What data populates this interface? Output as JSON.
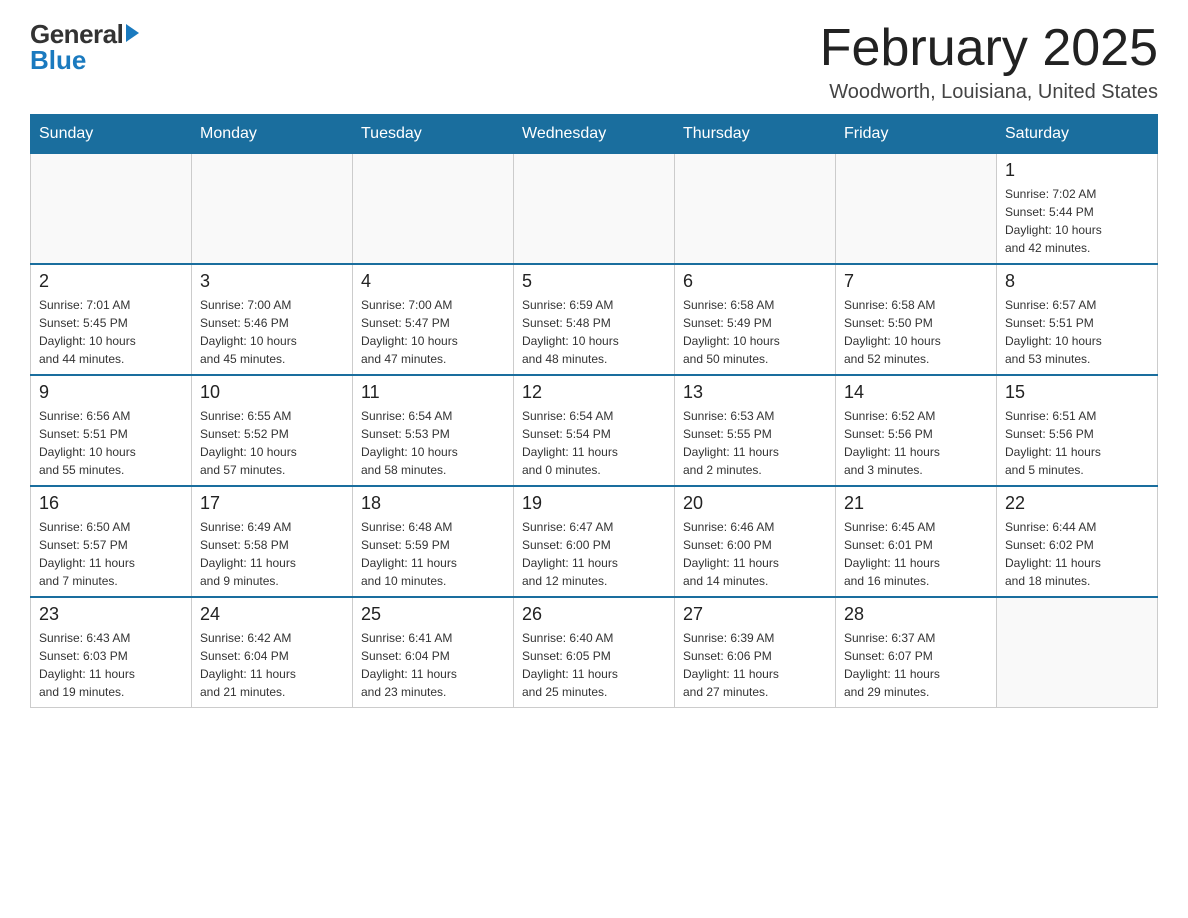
{
  "logo": {
    "general": "General",
    "blue": "Blue",
    "triangle": "▶"
  },
  "title": {
    "month_year": "February 2025",
    "location": "Woodworth, Louisiana, United States"
  },
  "days_of_week": [
    "Sunday",
    "Monday",
    "Tuesday",
    "Wednesday",
    "Thursday",
    "Friday",
    "Saturday"
  ],
  "weeks": [
    [
      {
        "day": "",
        "info": ""
      },
      {
        "day": "",
        "info": ""
      },
      {
        "day": "",
        "info": ""
      },
      {
        "day": "",
        "info": ""
      },
      {
        "day": "",
        "info": ""
      },
      {
        "day": "",
        "info": ""
      },
      {
        "day": "1",
        "info": "Sunrise: 7:02 AM\nSunset: 5:44 PM\nDaylight: 10 hours\nand 42 minutes."
      }
    ],
    [
      {
        "day": "2",
        "info": "Sunrise: 7:01 AM\nSunset: 5:45 PM\nDaylight: 10 hours\nand 44 minutes."
      },
      {
        "day": "3",
        "info": "Sunrise: 7:00 AM\nSunset: 5:46 PM\nDaylight: 10 hours\nand 45 minutes."
      },
      {
        "day": "4",
        "info": "Sunrise: 7:00 AM\nSunset: 5:47 PM\nDaylight: 10 hours\nand 47 minutes."
      },
      {
        "day": "5",
        "info": "Sunrise: 6:59 AM\nSunset: 5:48 PM\nDaylight: 10 hours\nand 48 minutes."
      },
      {
        "day": "6",
        "info": "Sunrise: 6:58 AM\nSunset: 5:49 PM\nDaylight: 10 hours\nand 50 minutes."
      },
      {
        "day": "7",
        "info": "Sunrise: 6:58 AM\nSunset: 5:50 PM\nDaylight: 10 hours\nand 52 minutes."
      },
      {
        "day": "8",
        "info": "Sunrise: 6:57 AM\nSunset: 5:51 PM\nDaylight: 10 hours\nand 53 minutes."
      }
    ],
    [
      {
        "day": "9",
        "info": "Sunrise: 6:56 AM\nSunset: 5:51 PM\nDaylight: 10 hours\nand 55 minutes."
      },
      {
        "day": "10",
        "info": "Sunrise: 6:55 AM\nSunset: 5:52 PM\nDaylight: 10 hours\nand 57 minutes."
      },
      {
        "day": "11",
        "info": "Sunrise: 6:54 AM\nSunset: 5:53 PM\nDaylight: 10 hours\nand 58 minutes."
      },
      {
        "day": "12",
        "info": "Sunrise: 6:54 AM\nSunset: 5:54 PM\nDaylight: 11 hours\nand 0 minutes."
      },
      {
        "day": "13",
        "info": "Sunrise: 6:53 AM\nSunset: 5:55 PM\nDaylight: 11 hours\nand 2 minutes."
      },
      {
        "day": "14",
        "info": "Sunrise: 6:52 AM\nSunset: 5:56 PM\nDaylight: 11 hours\nand 3 minutes."
      },
      {
        "day": "15",
        "info": "Sunrise: 6:51 AM\nSunset: 5:56 PM\nDaylight: 11 hours\nand 5 minutes."
      }
    ],
    [
      {
        "day": "16",
        "info": "Sunrise: 6:50 AM\nSunset: 5:57 PM\nDaylight: 11 hours\nand 7 minutes."
      },
      {
        "day": "17",
        "info": "Sunrise: 6:49 AM\nSunset: 5:58 PM\nDaylight: 11 hours\nand 9 minutes."
      },
      {
        "day": "18",
        "info": "Sunrise: 6:48 AM\nSunset: 5:59 PM\nDaylight: 11 hours\nand 10 minutes."
      },
      {
        "day": "19",
        "info": "Sunrise: 6:47 AM\nSunset: 6:00 PM\nDaylight: 11 hours\nand 12 minutes."
      },
      {
        "day": "20",
        "info": "Sunrise: 6:46 AM\nSunset: 6:00 PM\nDaylight: 11 hours\nand 14 minutes."
      },
      {
        "day": "21",
        "info": "Sunrise: 6:45 AM\nSunset: 6:01 PM\nDaylight: 11 hours\nand 16 minutes."
      },
      {
        "day": "22",
        "info": "Sunrise: 6:44 AM\nSunset: 6:02 PM\nDaylight: 11 hours\nand 18 minutes."
      }
    ],
    [
      {
        "day": "23",
        "info": "Sunrise: 6:43 AM\nSunset: 6:03 PM\nDaylight: 11 hours\nand 19 minutes."
      },
      {
        "day": "24",
        "info": "Sunrise: 6:42 AM\nSunset: 6:04 PM\nDaylight: 11 hours\nand 21 minutes."
      },
      {
        "day": "25",
        "info": "Sunrise: 6:41 AM\nSunset: 6:04 PM\nDaylight: 11 hours\nand 23 minutes."
      },
      {
        "day": "26",
        "info": "Sunrise: 6:40 AM\nSunset: 6:05 PM\nDaylight: 11 hours\nand 25 minutes."
      },
      {
        "day": "27",
        "info": "Sunrise: 6:39 AM\nSunset: 6:06 PM\nDaylight: 11 hours\nand 27 minutes."
      },
      {
        "day": "28",
        "info": "Sunrise: 6:37 AM\nSunset: 6:07 PM\nDaylight: 11 hours\nand 29 minutes."
      },
      {
        "day": "",
        "info": ""
      }
    ]
  ]
}
